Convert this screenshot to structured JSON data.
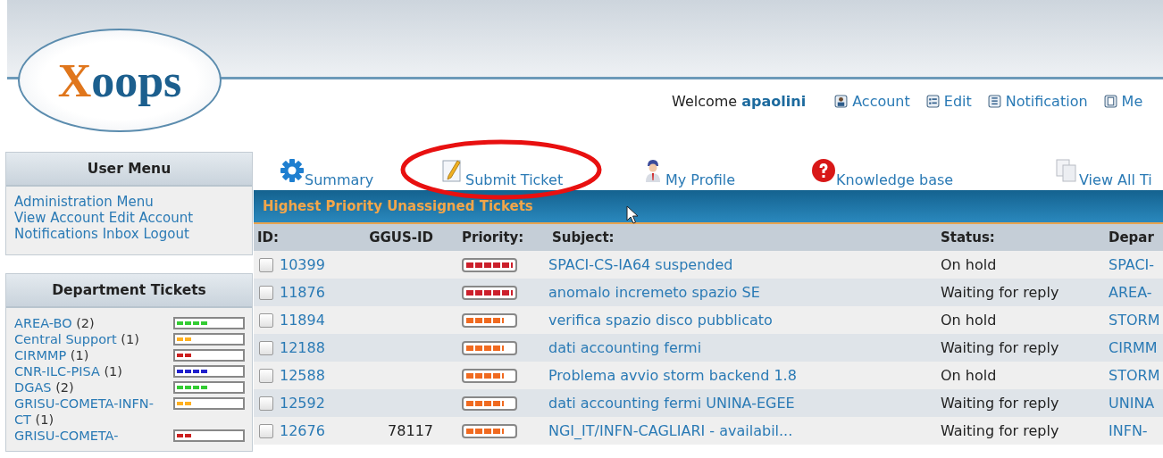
{
  "logo": {
    "text": "Xoops"
  },
  "welcome": {
    "label": "Welcome",
    "user": "apaolini"
  },
  "user_links": [
    {
      "label": "Account"
    },
    {
      "label": "Edit"
    },
    {
      "label": "Notification"
    },
    {
      "label": "Me"
    }
  ],
  "user_menu": {
    "title": "User Menu",
    "links": [
      "Administration Menu",
      "View Account",
      "Edit Account",
      "Notifications",
      "Inbox",
      "Logout"
    ]
  },
  "department_tickets": {
    "title": "Department Tickets",
    "items": [
      {
        "name": "AREA-BO",
        "count": "(2)",
        "level": 0.5,
        "color": "#33cc33"
      },
      {
        "name": "Central Support",
        "count": "(1)",
        "level": 0.25,
        "color": "#ffb020"
      },
      {
        "name": "CIRMMP",
        "count": "(1)",
        "level": 0.25,
        "color": "#cc2020"
      },
      {
        "name": "CNR-ILC-PISA",
        "count": "(1)",
        "level": 0.5,
        "color": "#2020cc"
      },
      {
        "name": "DGAS",
        "count": "(2)",
        "level": 0.5,
        "color": "#33cc33"
      },
      {
        "name": "GRISU-COMETA-INFN-CT",
        "count": "(1)",
        "level": 0.25,
        "color": "#ffb020"
      },
      {
        "name": "GRISU-COMETA-",
        "level": 0.25,
        "color": "#cc2020"
      }
    ]
  },
  "nav": [
    {
      "label": "Summary",
      "circled": false
    },
    {
      "label": "Submit Ticket",
      "circled": true
    },
    {
      "label": "My Profile",
      "circled": false
    },
    {
      "label": "Knowledge base",
      "circled": false
    },
    {
      "label": "View All Ti",
      "circled": false
    }
  ],
  "table": {
    "title": "Highest Priority Unassigned Tickets",
    "columns": [
      "ID:",
      "GGUS-ID",
      "Priority:",
      "Subject:",
      "Status:",
      "Depar"
    ],
    "rows": [
      {
        "checked": false,
        "id": "10399",
        "priority": {
          "level": 1,
          "color": "#cc1f2b"
        },
        "subject": "SPACI-CS-IA64 suspended",
        "status": "On hold",
        "department": "SPACI-"
      },
      {
        "checked": false,
        "id": "11876",
        "priority": {
          "level": 1,
          "color": "#cc1f2b"
        },
        "subject": "anomalo incremeto spazio SE",
        "status": "Waiting for reply",
        "department": "AREA-"
      },
      {
        "checked": false,
        "id": "11894",
        "priority": {
          "level": 0.8,
          "color": "#f06a20"
        },
        "subject": "verifica spazio disco pubblicato",
        "status": "On hold",
        "department": "STORM"
      },
      {
        "checked": false,
        "id": "12188",
        "priority": {
          "level": 0.8,
          "color": "#f06a20"
        },
        "subject": "dati accounting fermi",
        "status": "Waiting for reply",
        "department": "CIRMM"
      },
      {
        "checked": false,
        "id": "12588",
        "priority": {
          "level": 0.8,
          "color": "#f06a20"
        },
        "subject": "Problema avvio storm backend 1.8",
        "status": "On hold",
        "department": "STORM"
      },
      {
        "checked": false,
        "id": "12592",
        "priority": {
          "level": 0.8,
          "color": "#f06a20"
        },
        "subject": "dati accounting fermi UNINA-EGEE",
        "status": "Waiting for reply",
        "department": "UNINA"
      },
      {
        "checked": false,
        "id": "12676",
        "ggus": "78117",
        "priority": {
          "level": 0.8,
          "color": "#f06a20"
        },
        "subject": "NGI_IT/INFN-CAGLIARI - availabil...",
        "status": "Waiting for reply",
        "department": "INFN-"
      }
    ]
  }
}
